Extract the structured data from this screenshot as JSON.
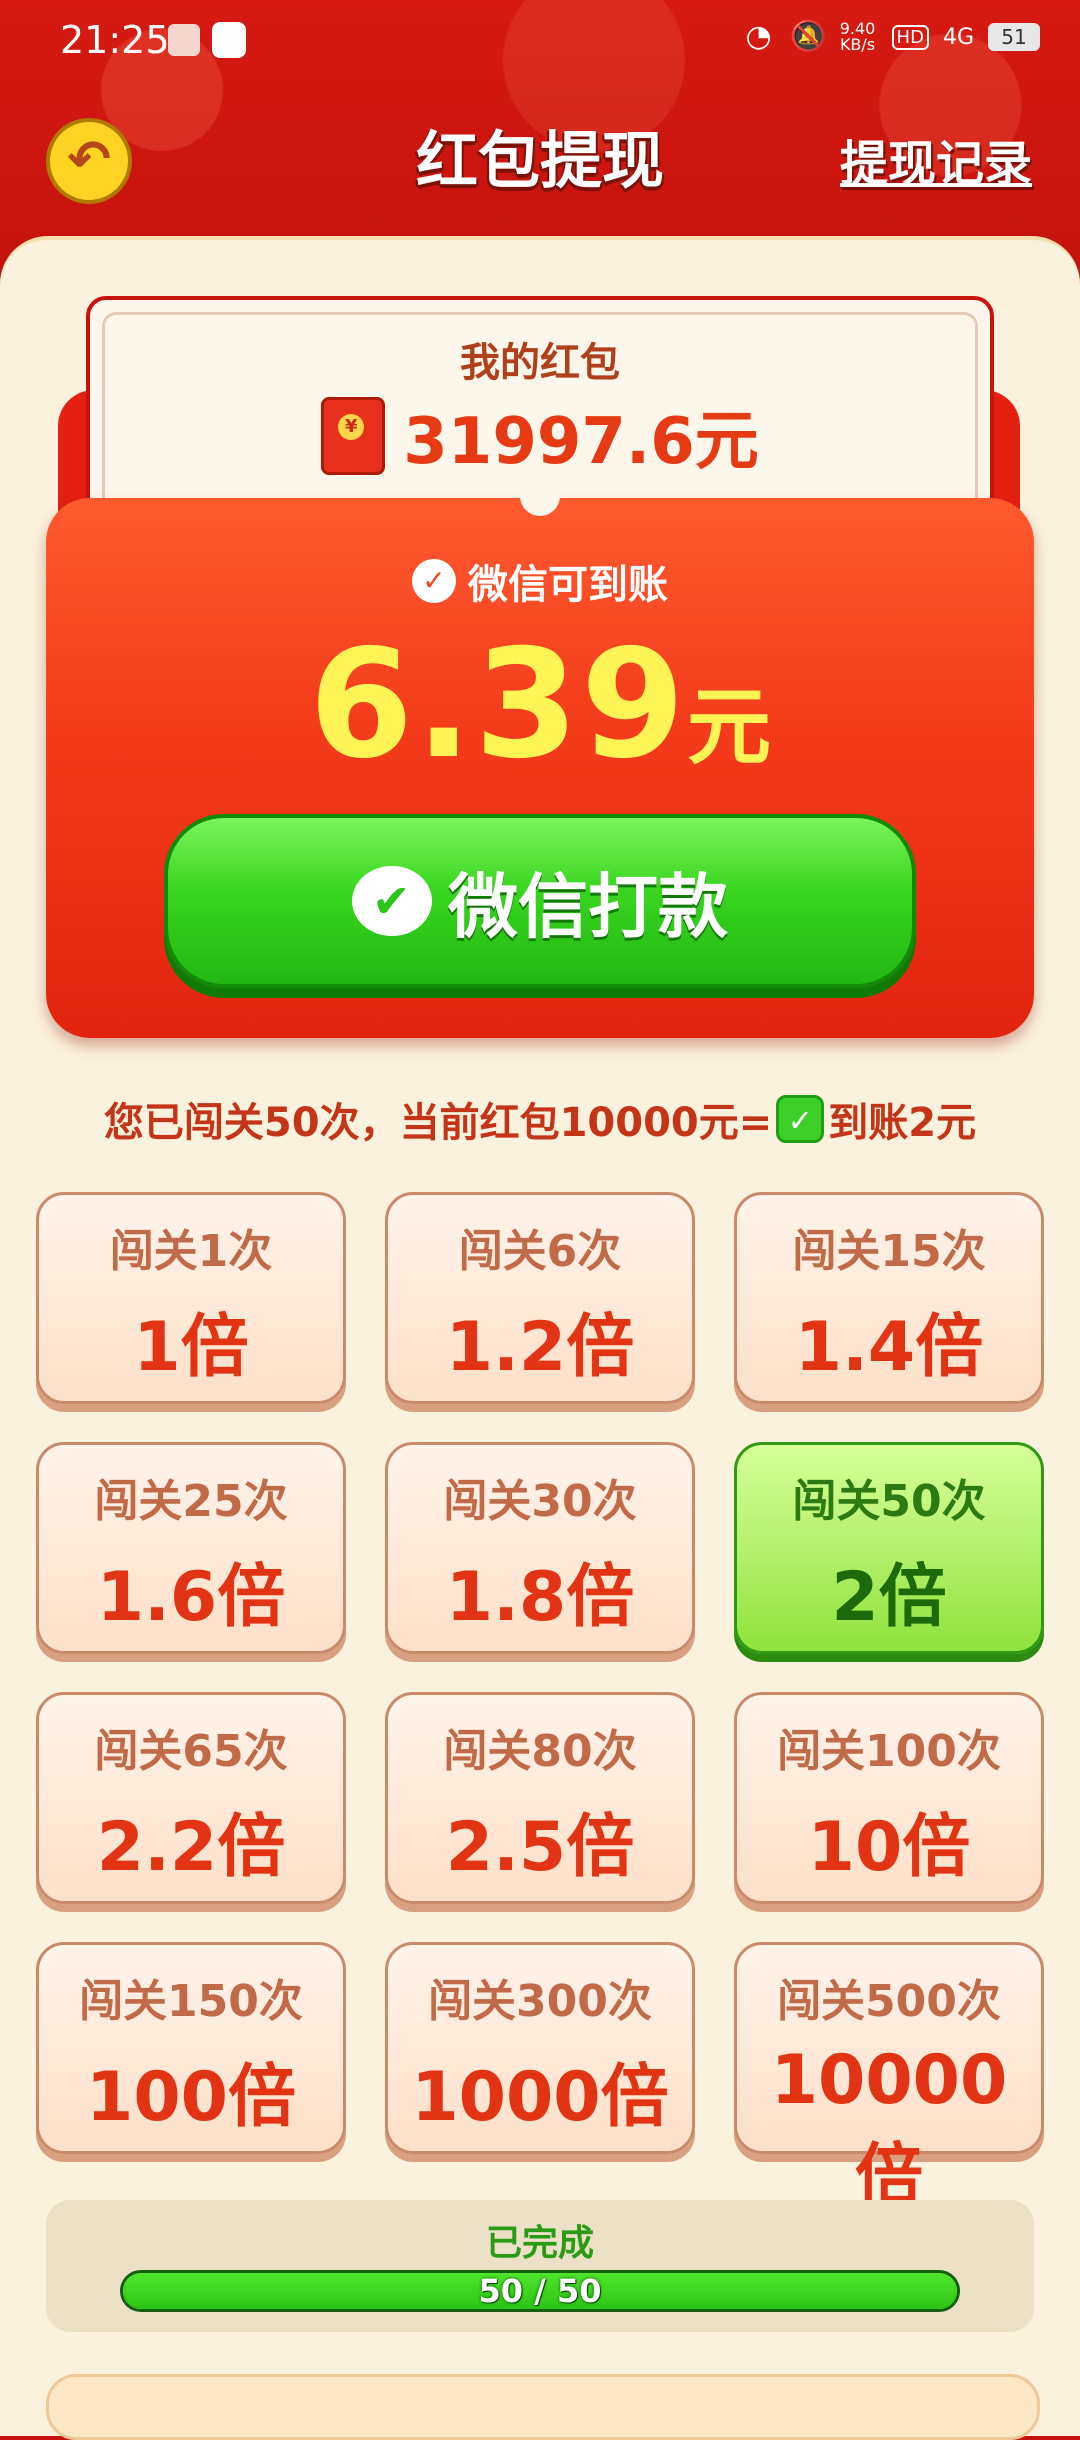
{
  "status_bar": {
    "time": "21:25",
    "net_speed_value": "9.40",
    "net_speed_unit": "KB/s",
    "hd": "HD",
    "signal": "4G",
    "battery": "51"
  },
  "header": {
    "back_icon": "back-arrow-icon",
    "title": "红包提现",
    "history_link": "提现记录"
  },
  "wallet": {
    "label": "我的红包",
    "amount": "31997.6元",
    "icon": "red-packet-icon"
  },
  "withdraw": {
    "wechat_note": "微信可到账",
    "amount": "6.39",
    "unit": "元",
    "button_label": "微信打款",
    "button_icon": "wechat-icon"
  },
  "level_info": {
    "prefix": "您已闯关50次，当前红包10000元=",
    "suffix": "到账2元"
  },
  "tiers": [
    {
      "label": "闯关1次",
      "value": "1倍",
      "active": false
    },
    {
      "label": "闯关6次",
      "value": "1.2倍",
      "active": false
    },
    {
      "label": "闯关15次",
      "value": "1.4倍",
      "active": false
    },
    {
      "label": "闯关25次",
      "value": "1.6倍",
      "active": false
    },
    {
      "label": "闯关30次",
      "value": "1.8倍",
      "active": false
    },
    {
      "label": "闯关50次",
      "value": "2倍",
      "active": true
    },
    {
      "label": "闯关65次",
      "value": "2.2倍",
      "active": false
    },
    {
      "label": "闯关80次",
      "value": "2.5倍",
      "active": false
    },
    {
      "label": "闯关100次",
      "value": "10倍",
      "active": false
    },
    {
      "label": "闯关150次",
      "value": "100倍",
      "active": false
    },
    {
      "label": "闯关300次",
      "value": "1000倍",
      "active": false
    },
    {
      "label": "闯关500次",
      "value": "10000倍",
      "active": false
    }
  ],
  "progress": {
    "label": "已完成",
    "text": "50 / 50",
    "fraction": 1.0
  },
  "colors": {
    "header_red": "#c8120f",
    "panel_cream": "#fbf2de",
    "accent_orange": "#f33a1a",
    "wechat_green": "#37d41e",
    "amount_yellow": "#fff456"
  }
}
